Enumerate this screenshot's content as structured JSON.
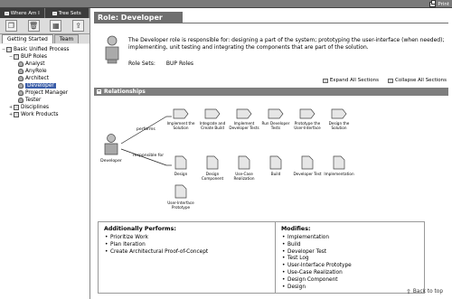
{
  "topbar": {
    "print_label": "Print"
  },
  "nav": {
    "tabs": [
      {
        "label": "Where Am I",
        "icon": "where-am-i-icon"
      },
      {
        "label": "Tree Sets",
        "icon": "tree-sets-icon"
      }
    ],
    "tools": [
      "copy-icon",
      "delete-icon",
      "config-icon",
      "refresh-icon"
    ],
    "subtabs": [
      "Getting Started",
      "Team"
    ]
  },
  "tree": {
    "root1": "Basic Unified Process",
    "root2": "BUP Roles",
    "roles": [
      "Analyst",
      "AnyRole",
      "Architect",
      "Developer",
      "Project Manager",
      "Tester"
    ],
    "root3": "Disciplines",
    "root4": "Work Products"
  },
  "page": {
    "title": "Role: Developer",
    "description": "The Developer role is responsible for: designing a part of the system; prototyping the user-interface (when needed); implementing, unit testing and integrating the components that are part of the solution.",
    "role_sets_label": "Role Sets:",
    "role_sets_value": "BUP Roles",
    "expand_all": "Expand All Sections",
    "collapse_all": "Collapse All Sections",
    "relationships_label": "Relationships",
    "back_to_top": "Back to top"
  },
  "diagram": {
    "role_label": "Developer",
    "performs_label": "performs",
    "responsible_label": "responsible for",
    "tasks": [
      {
        "l1": "Implement the",
        "l2": "Solution"
      },
      {
        "l1": "Integrate and",
        "l2": "Create Build"
      },
      {
        "l1": "Implement",
        "l2": "Developer Tests"
      },
      {
        "l1": "Run Developer",
        "l2": "Tests"
      },
      {
        "l1": "Prototype the",
        "l2": "User-Interface"
      },
      {
        "l1": "Design the",
        "l2": "Solution"
      }
    ],
    "artifacts": [
      {
        "l1": "Design",
        "l2": ""
      },
      {
        "l1": "Design",
        "l2": "Component"
      },
      {
        "l1": "Use-Case",
        "l2": "Realization"
      },
      {
        "l1": "Build",
        "l2": ""
      },
      {
        "l1": "Developer Test",
        "l2": ""
      },
      {
        "l1": "Implementation",
        "l2": ""
      }
    ],
    "extra_artifact": {
      "l1": "User-Interface",
      "l2": "Prototype"
    }
  },
  "additionally_performs": {
    "title": "Additionally Performs:",
    "items": [
      "Prioritize Work",
      "Plan Iteration",
      "Create Architectural Proof-of-Concept"
    ]
  },
  "modifies": {
    "title": "Modifies:",
    "items": [
      "Implementation",
      "Build",
      "Developer Test",
      "Test Log",
      "User-Interface Prototype",
      "Use-Case Realization",
      "Design Component",
      "Design"
    ]
  }
}
